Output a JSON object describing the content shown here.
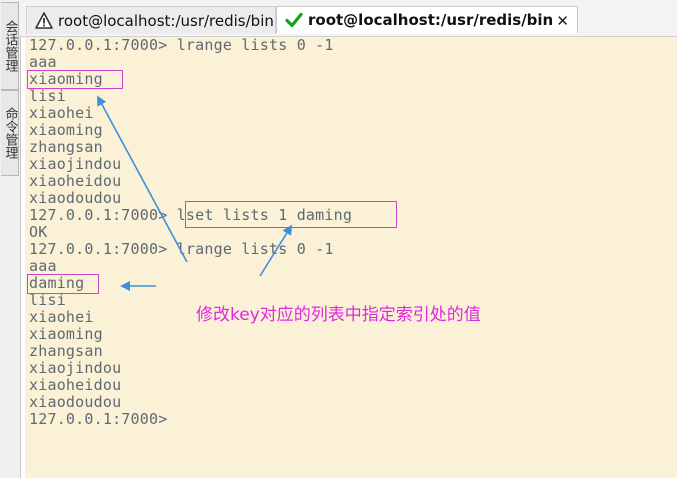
{
  "sidebar": {
    "tabs": [
      {
        "label": "会话管理"
      },
      {
        "label": "命令管理"
      }
    ]
  },
  "tabs": [
    {
      "title": "root@localhost:/usr/redis/bin",
      "status_icon": "warning-icon",
      "active": false
    },
    {
      "title": "root@localhost:/usr/redis/bin",
      "status_icon": "checkmark-icon",
      "active": true,
      "close_glyph": "✕"
    }
  ],
  "terminal": {
    "lines": [
      "127.0.0.1:7000> lrange lists 0 -1",
      "aaa",
      "xiaoming",
      "lisi",
      "xiaohei",
      "xiaoming",
      "zhangsan",
      "xiaojindou",
      "xiaoheidou",
      "xiaodoudou",
      "127.0.0.1:7000> lset lists 1 daming",
      "OK",
      "127.0.0.1:7000> lrange lists 0 -1",
      "aaa",
      "daming",
      "lisi",
      "xiaohei",
      "xiaoming",
      "zhangsan",
      "xiaojindou",
      "xiaoheidou",
      "xiaodoudou",
      "127.0.0.1:7000>"
    ]
  },
  "annotation": {
    "text": "修改key对应的列表中指定索引处的值"
  },
  "colors": {
    "terminal_bg": "#fbf1d6",
    "terminal_fg": "#5e6a73",
    "highlight": "#cc44cc",
    "annotation": "#e028e0",
    "arrow": "#3b8fdc"
  }
}
